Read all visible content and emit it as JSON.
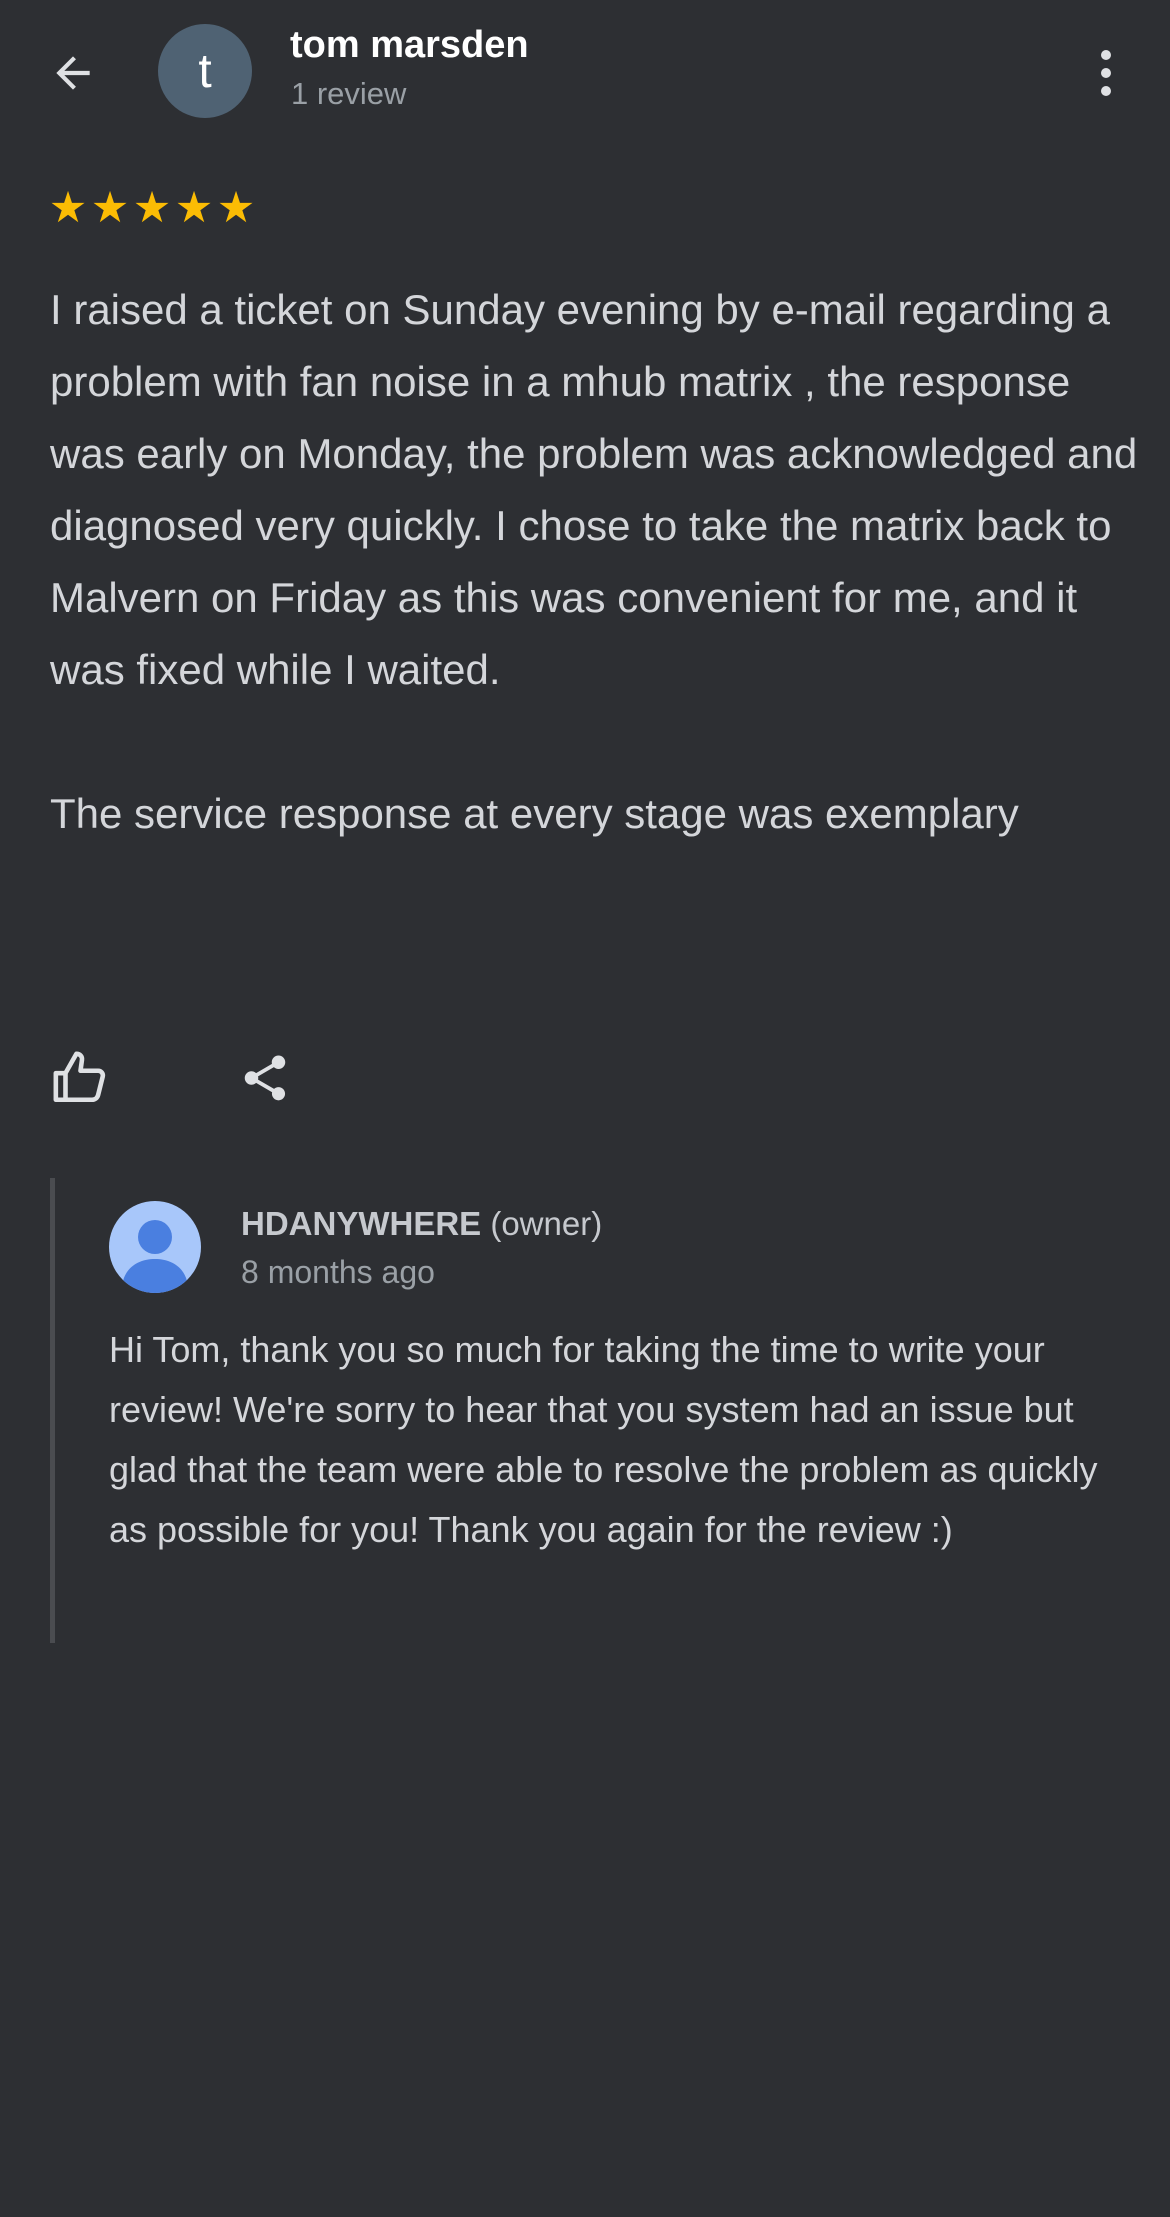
{
  "header": {
    "avatar_letter": "t",
    "reviewer_name": "tom marsden",
    "review_count": "1 review",
    "back_icon": "arrow-left-icon",
    "more_icon": "more-vert-icon"
  },
  "review": {
    "rating": 5,
    "max_rating": 5,
    "star_color": "#fbbc04",
    "text": "I raised a ticket on Sunday evening by e-mail regarding a problem with fan noise in a mhub matrix , the response was early on Monday, the problem was acknowledged and diagnosed very quickly. I chose to take the matrix back to Malvern on Friday as this was convenient for me, and it was fixed while I waited.\n\nThe service response at every stage was exemplary",
    "like_icon": "thumb-up-icon",
    "share_icon": "share-icon"
  },
  "owner_reply": {
    "name": "HDANYWHERE",
    "role": "(owner)",
    "time": "8 months ago",
    "text": "Hi Tom, thank you so much for taking the time to write your review! We're sorry to hear that you system had an issue but glad that the team were able to resolve the problem as quickly as possible for you! Thank you again for the review :)"
  },
  "colors": {
    "background": "#2d2f33",
    "avatar_bg": "#4f6273",
    "owner_avatar_bg": "#a8c7fa",
    "owner_avatar_fg": "#4a7fe0"
  }
}
